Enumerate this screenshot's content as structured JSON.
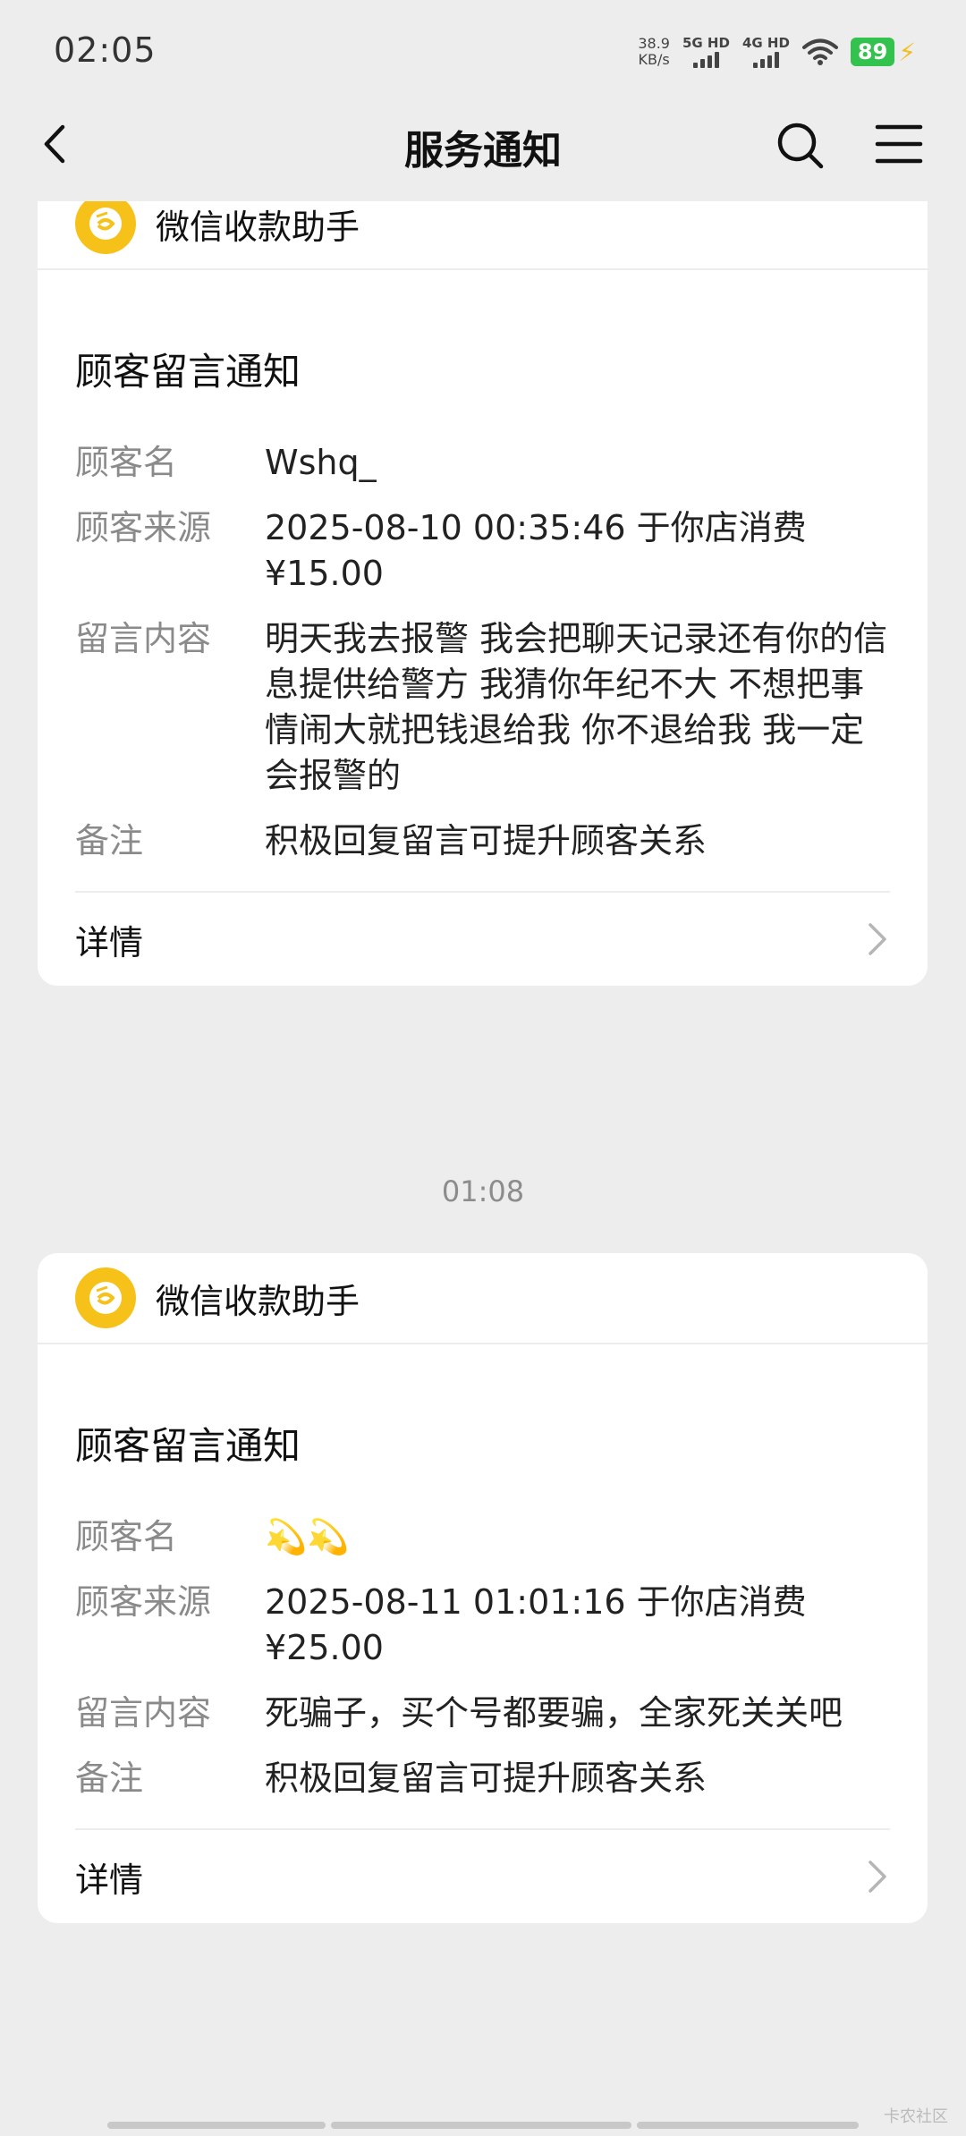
{
  "status_bar": {
    "time": "02:05",
    "net_speed_value": "38.9",
    "net_speed_unit": "KB/s",
    "signal_1": "5G HD",
    "signal_2": "4G HD",
    "battery": "89",
    "battery_color": "#33c24d"
  },
  "nav": {
    "title": "服务通知"
  },
  "cards": [
    {
      "app_name": "微信收款助手",
      "title": "顾客留言通知",
      "fields": [
        {
          "label": "顾客名",
          "value": "Wshq_"
        },
        {
          "label": "顾客来源",
          "value": "2025-08-10 00:35:46 于你店消费\n¥15.00"
        },
        {
          "label": "留言内容",
          "value": "明天我去报警 我会把聊天记录还有你的信息提供给警方 我猜你年纪不大 不想把事情闹大就把钱退给我 你不退给我 我一定会报警的"
        },
        {
          "label": "备注",
          "value": "积极回复留言可提升顾客关系"
        }
      ],
      "detail_label": "详情"
    },
    {
      "app_name": "微信收款助手",
      "title": "顾客留言通知",
      "fields": [
        {
          "label": "顾客名",
          "value": "💫💫"
        },
        {
          "label": "顾客来源",
          "value": "2025-08-11 01:01:16 于你店消费\n¥25.00"
        },
        {
          "label": "留言内容",
          "value": "死骗子，买个号都要骗，全家死关关吧"
        },
        {
          "label": "备注",
          "value": "积极回复留言可提升顾客关系"
        }
      ],
      "detail_label": "详情"
    }
  ],
  "time_divider": "01:08",
  "watermark": "卡农社区",
  "colors": {
    "background": "#ededed",
    "card": "#ffffff",
    "logo": "#f6c21a",
    "label_gray": "#8a8a8a"
  }
}
